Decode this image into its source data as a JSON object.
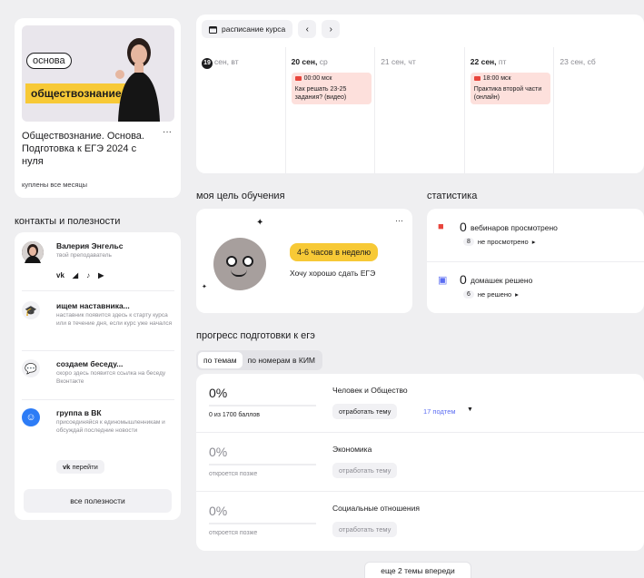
{
  "course": {
    "banner_badge": "основа",
    "banner_subject": "обществознание",
    "title": "Обществознание. Основа. Подготовка к ЕГЭ 2024 с нуля",
    "menu": "···",
    "status": "куплены все месяцы"
  },
  "contacts": {
    "heading": "контакты и полезности",
    "teacher": {
      "name": "Валерия Энгельс",
      "role": "твой преподаватель",
      "socials": [
        "vk",
        "telegram",
        "tiktok",
        "youtube"
      ],
      "social_labels": {
        "vk": "vk",
        "telegram": "◢",
        "tiktok": "♪",
        "youtube": "▶"
      }
    },
    "mentor": {
      "name": "ищем наставника...",
      "desc": "наставник появится здесь к старту курса или в течение дня, если курс уже начался"
    },
    "chat": {
      "name": "создаем беседу...",
      "desc": "скоро здесь появится ссылка на беседу Вконтакте"
    },
    "vk_group": {
      "name": "группа в ВК",
      "desc": "присоединяйся к единомышленникам и обсуждай последние новости",
      "button": "перейти",
      "button_prefix": "vk"
    },
    "all_button": "все полезности"
  },
  "schedule": {
    "button_label": "расписание курса",
    "prev": "‹",
    "next": "›",
    "days": [
      {
        "num": "19",
        "bold": "",
        "rest": "сен, вт",
        "today": true
      },
      {
        "num": "",
        "bold": "20 сен,",
        "rest": " ср",
        "event": {
          "time": "00:00 мск",
          "title": "Как решать 23-25 задания? (видео)"
        }
      },
      {
        "num": "",
        "bold": "",
        "rest": "21 сен, чт"
      },
      {
        "num": "",
        "bold": "22 сен,",
        "rest": " пт",
        "event": {
          "time": "18:00 мск",
          "title": "Практика второй части (онлайн)"
        }
      },
      {
        "num": "",
        "bold": "",
        "rest": "23 сен, сб"
      }
    ]
  },
  "goal": {
    "heading": "моя цель обучения",
    "hours": "4-6 часов в неделю",
    "text": "Хочу хорошо сдать ЕГЭ",
    "menu": "···"
  },
  "stats": {
    "heading": "статистика",
    "webinars": {
      "value": "0",
      "label": "вебинаров просмотрено",
      "count": "8",
      "sub": "не просмотрено"
    },
    "homework": {
      "value": "0",
      "label": "домашек решено",
      "count": "6",
      "sub": "не решено"
    }
  },
  "progress": {
    "heading": "прогресс подготовки к егэ",
    "tabs": [
      "по темам",
      "по номерам в КИМ"
    ],
    "rows": [
      {
        "pct": "0%",
        "points": "0 из 1700 баллов",
        "topic": "Человек и Общество",
        "button": "отработать тему",
        "subtopics": "17 подтем",
        "active": true
      },
      {
        "pct": "0%",
        "points": "откроется позже",
        "topic": "Экономика",
        "button": "отработать тему",
        "active": false
      },
      {
        "pct": "0%",
        "points": "откроется позже",
        "topic": "Социальные отношения",
        "button": "отработать тему",
        "active": false
      }
    ],
    "more_button": "еще 2 темы впереди"
  },
  "colors": {
    "accent_yellow": "#f7c936",
    "event_pink": "#fde0dc",
    "link_blue": "#5b6df2",
    "vk_blue": "#2d7cf6"
  }
}
